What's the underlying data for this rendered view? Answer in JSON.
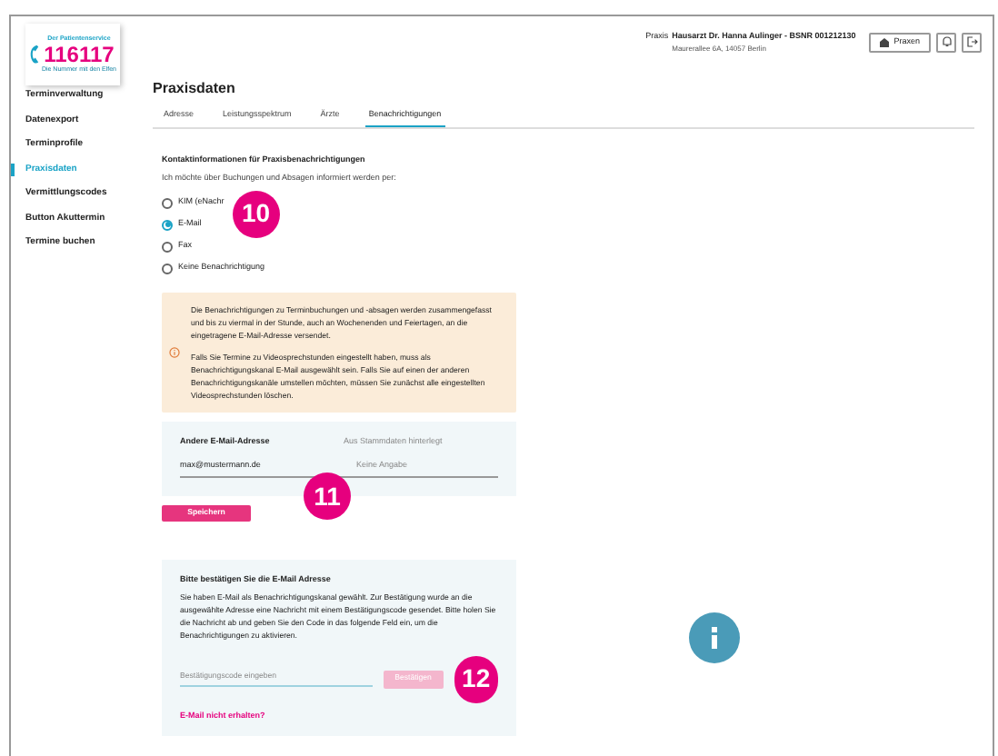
{
  "logo": {
    "tagline": "Der Patientenservice",
    "number": "116117",
    "slogan": "Die Nummer mit den Elfen"
  },
  "header": {
    "prefix": "Praxis",
    "practice": "Hausarzt Dr. Hanna Aulinger - BSNR 001212130",
    "address": "Maurerallee 6A, 14057 Berlin",
    "button": "Praxen"
  },
  "sidebar": {
    "items": [
      {
        "label": "Terminverwaltung",
        "selected": false
      },
      {
        "label": "Datenexport",
        "selected": false
      },
      {
        "label": "Terminprofile",
        "selected": false
      },
      {
        "label": "Praxisdaten",
        "selected": true
      },
      {
        "label": "Vermittlungscodes",
        "selected": false
      },
      {
        "label": "Button Akuttermin",
        "selected": false
      },
      {
        "label": "Termine buchen",
        "selected": false
      }
    ]
  },
  "page_title": "Praxisdaten",
  "tabs": [
    {
      "label": "Adresse",
      "selected": false
    },
    {
      "label": "Leistungsspektrum",
      "selected": false
    },
    {
      "label": "Ärzte",
      "selected": false
    },
    {
      "label": "Benachrichtigungen",
      "selected": true
    }
  ],
  "section_title": "Kontaktinformationen für Praxisbenachrichtigungen",
  "section_intro": "Ich möchte über Buchungen und Absagen informiert werden per:",
  "options": [
    {
      "label": "KIM (eNachr",
      "selected": false
    },
    {
      "label": "E-Mail",
      "selected": true
    },
    {
      "label": "Fax",
      "selected": false
    },
    {
      "label": "Keine Benachrichtigung",
      "selected": false
    }
  ],
  "notice": [
    "Die Benachrichtigungen zu Terminbuchungen und -absagen werden zusammengefasst und bis zu viermal in der Stunde, auch an Wochenenden und Feiertagen, an die eingetragene E-Mail-Adresse versendet.",
    "Falls Sie Termine zu Videosprechstunden eingestellt haben, muss als Benachrichtigungskanal E-Mail ausgewählt sein. Falls Sie auf einen der anderen Benachrichtigungskanäle umstellen möchten, müssen Sie zunächst alle eingestellten Videosprechstunden löschen."
  ],
  "email_panel": {
    "label": "Andere E-Mail-Adresse",
    "value": "max@mustermann.de",
    "stored_label": "Aus Stammdaten hinterlegt",
    "stored_value": "Keine Angabe"
  },
  "save_button": "Speichern",
  "confirm": {
    "title": "Bitte bestätigen Sie die E-Mail Adresse",
    "text": "Sie haben E-Mail als Benachrichtigungskanal gewählt. Zur Bestätigung wurde an die ausgewählte Adresse eine Nachricht mit einem Bestätigungscode gesendet. Bitte holen Sie die Nachricht ab und geben Sie den Code in das folgende Feld ein, um die Benachrichtigungen zu aktivieren.",
    "placeholder": "Bestätigungscode eingeben",
    "button": "Bestätigen",
    "link": "E-Mail nicht erhalten?"
  },
  "markers": [
    "10",
    "11",
    "12"
  ]
}
